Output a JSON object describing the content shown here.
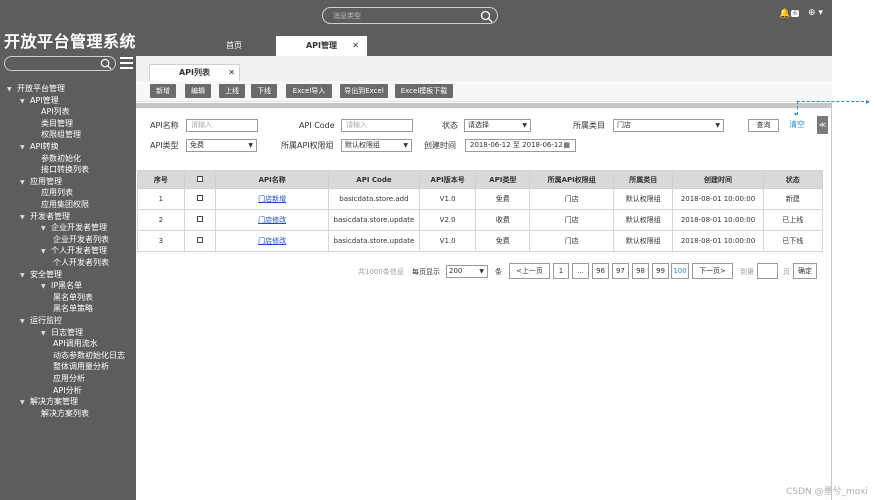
{
  "app": {
    "title": "开放平台管理系统",
    "search_placeholder": "消息类型",
    "notifications_count": "6",
    "user_menu": "▾"
  },
  "main_tabs": [
    {
      "label": "首页"
    },
    {
      "label": "API管理",
      "close": "✕"
    }
  ],
  "sidebar": {
    "items": [
      {
        "label": "开放平台管理",
        "level": 0,
        "arrow": "▼"
      },
      {
        "label": "API管理",
        "level": 1,
        "arrow": "▼"
      },
      {
        "label": "API列表",
        "level": 2
      },
      {
        "label": "类目管理",
        "level": 2
      },
      {
        "label": "权限组管理",
        "level": 2
      },
      {
        "label": "API转换",
        "level": 1,
        "arrow": "▼"
      },
      {
        "label": "参数初始化",
        "level": 2
      },
      {
        "label": "接口转换列表",
        "level": 2
      },
      {
        "label": "应用管理",
        "level": 1,
        "arrow": "▼"
      },
      {
        "label": "应用列表",
        "level": 2
      },
      {
        "label": "应用集团权限",
        "level": 2
      },
      {
        "label": "开发者管理",
        "level": 1,
        "arrow": "▼"
      },
      {
        "label": "企业开发者管理",
        "level": 2,
        "arrow": "▼"
      },
      {
        "label": "企业开发者列表",
        "level": 3
      },
      {
        "label": "个人开发者管理",
        "level": 2,
        "arrow": "▼"
      },
      {
        "label": "个人开发者列表",
        "level": 3
      },
      {
        "label": "安全管理",
        "level": 1,
        "arrow": "▼"
      },
      {
        "label": "IP黑名单",
        "level": 2,
        "arrow": "▼"
      },
      {
        "label": "黑名单列表",
        "level": 3
      },
      {
        "label": "黑名单策略",
        "level": 3
      },
      {
        "label": "运行监控",
        "level": 1,
        "arrow": "▼"
      },
      {
        "label": "日志管理",
        "level": 2,
        "arrow": "▼"
      },
      {
        "label": "API调用流水",
        "level": 3
      },
      {
        "label": "动态参数初始化日志",
        "level": 3
      },
      {
        "label": "整体调用量分析",
        "level": 3
      },
      {
        "label": "应用分析",
        "level": 3
      },
      {
        "label": "API分析",
        "level": 3
      },
      {
        "label": "解决方案管理",
        "level": 1,
        "arrow": "▼"
      },
      {
        "label": "解决方案列表",
        "level": 2
      }
    ]
  },
  "subtab": {
    "label": "API列表",
    "close": "✕"
  },
  "toolbar": {
    "buttons": [
      "新增",
      "编辑",
      "上线",
      "下线",
      "Excel导入",
      "导出到Excel",
      "Excel模板下载"
    ]
  },
  "filters": {
    "api_name_label": "API名称",
    "api_name_placeholder": "请输入",
    "api_code_label": "API Code",
    "api_code_placeholder": "请输入",
    "status_label": "状态",
    "status_value": "请选择",
    "category_label": "所属类目",
    "category_value": "门店",
    "api_type_label": "API类型",
    "api_type_value": "免费",
    "perm_group_label": "所属API权限组",
    "perm_group_value": "默认权限组",
    "created_label": "创建时间",
    "created_value": "2018-06-12 至 2018-06-12",
    "query_label": "查询",
    "clear_label": "清空",
    "collapse_icon": "≪"
  },
  "table": {
    "columns": [
      "序号",
      "",
      "API名称",
      "API Code",
      "API版本号",
      "API类型",
      "所属API权限组",
      "所属类目",
      "创建时间",
      "状态"
    ],
    "rows": [
      [
        "1",
        "",
        "门店新增",
        "basicdata.store.add",
        "V1.0",
        "免费",
        "门店",
        "默认权限组",
        "2018-08-01 10:00:00",
        "新建"
      ],
      [
        "2",
        "",
        "门店修改",
        "basicdata.store.update",
        "V2.0",
        "收费",
        "门店",
        "默认权限组",
        "2018-08-01 10:00:00",
        "已上线"
      ],
      [
        "3",
        "",
        "门店修改",
        "basicdata.store.update",
        "V1.0",
        "免费",
        "门店",
        "默认权限组",
        "2018-08-01 10:00:00",
        "已下线"
      ]
    ]
  },
  "pagination": {
    "total": "共1000条信息",
    "per_page_label": "每页显示",
    "per_page_value": "200",
    "unit": "条",
    "prev": "<上一页",
    "pages": [
      "1",
      "...",
      "96",
      "97",
      "98",
      "99",
      "100"
    ],
    "next": "下一页>",
    "goto_label": "到第",
    "goto_unit": "页",
    "confirm": "确定"
  },
  "watermark": "CSDN @墨兮_moxi"
}
